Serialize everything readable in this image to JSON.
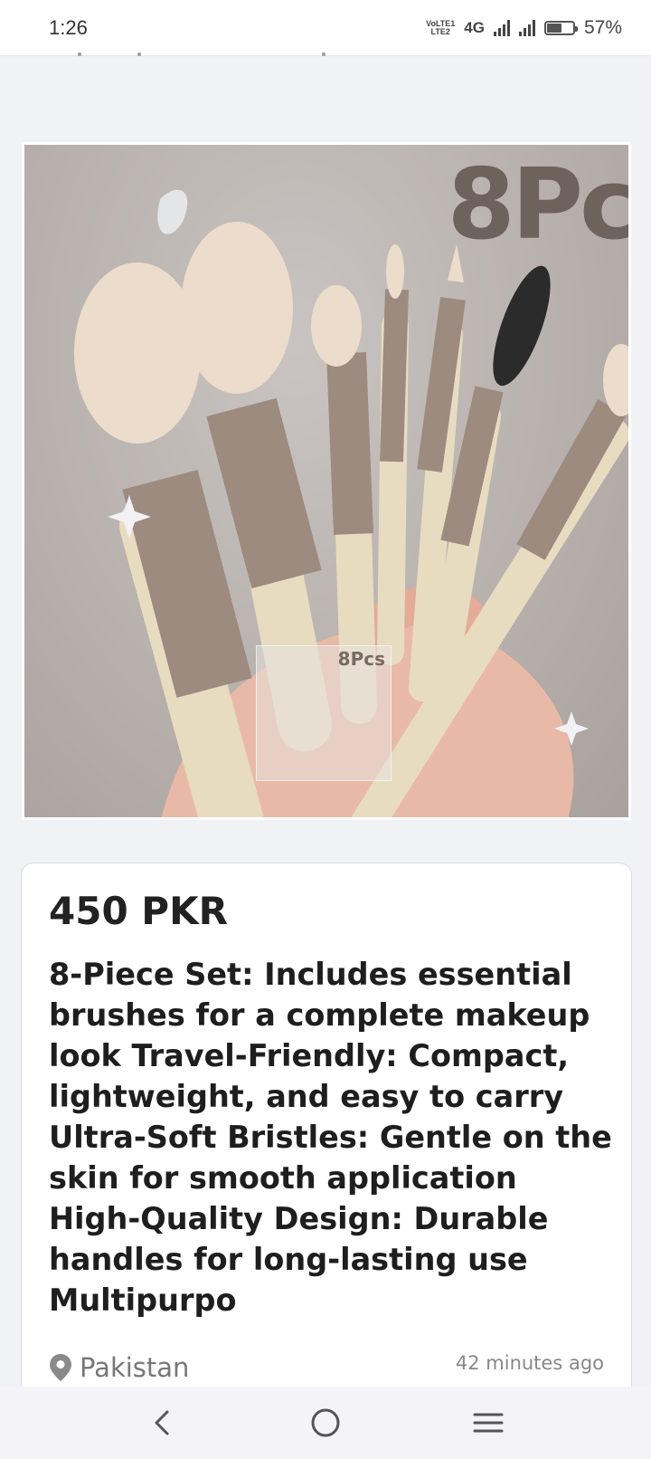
{
  "status_bar": {
    "time": "1:26",
    "network_label_top": "VoLTE1",
    "network_label_bottom": "LTE2",
    "network_type": "4G",
    "battery_percent": "57%",
    "battery_level": 0.57
  },
  "listing": {
    "image_label": "8Pc",
    "thumbnail_label": "8Pcs",
    "price": "450 PKR",
    "description": "8-Piece Set: Includes essential brushes for a complete makeup look Travel-Friendly: Compact, lightweight, and easy to carry Ultra-Soft Bristles: Gentle on the skin for smooth application High-Quality Design: Durable handles for long-lasting use Multipurpo",
    "location": "Pakistan",
    "posted": "42 minutes ago"
  },
  "icons": {
    "location": "location-pin-icon",
    "back": "back-icon",
    "home": "home-icon",
    "menu": "menu-icon"
  },
  "colors": {
    "background": "#f1f2f6",
    "card": "#ffffff",
    "text": "#1e1e1e",
    "muted": "#777777"
  }
}
